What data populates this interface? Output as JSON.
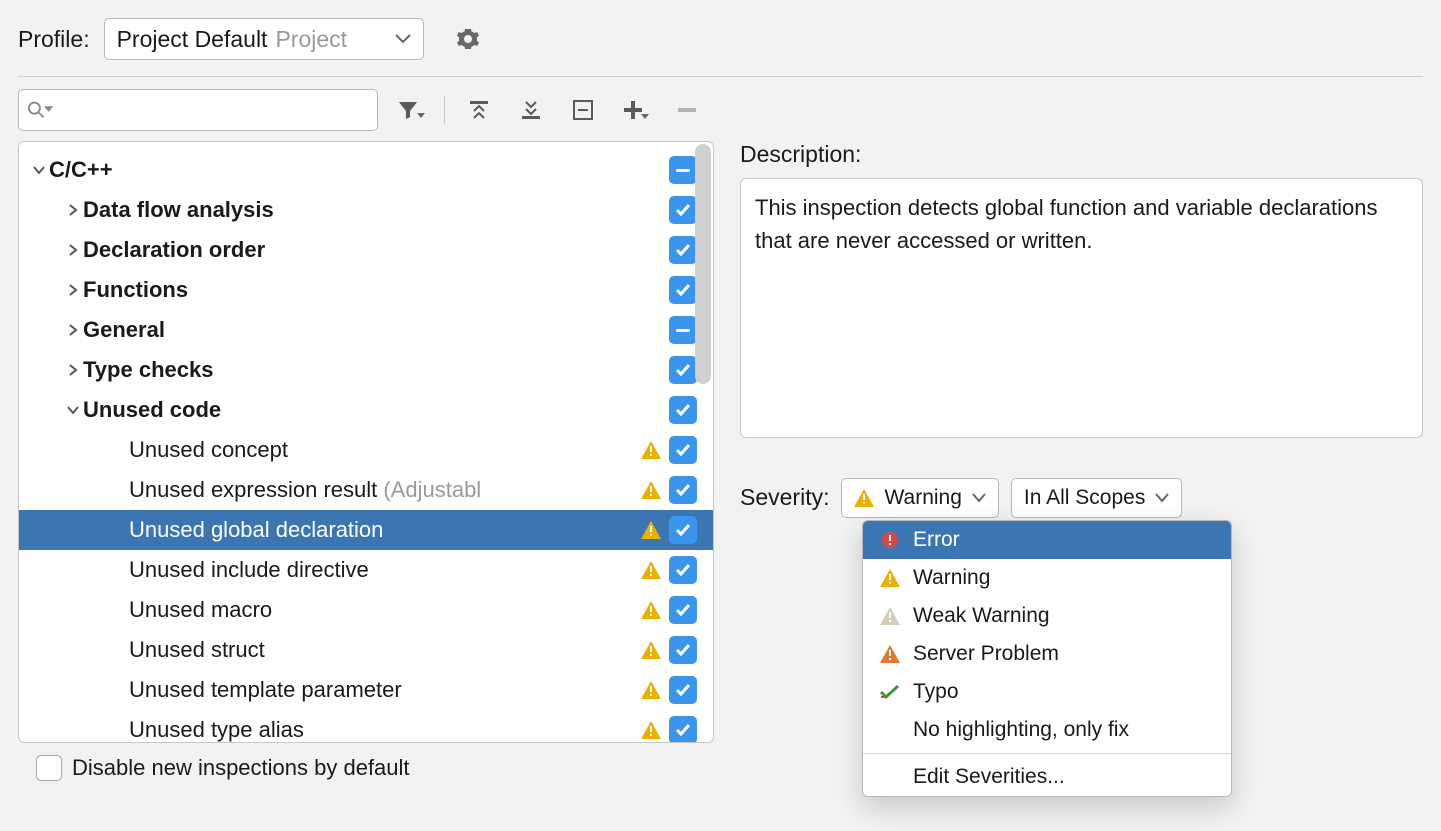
{
  "profile": {
    "label": "Profile:",
    "name": "Project Default",
    "scope": "Project"
  },
  "search": {
    "placeholder": ""
  },
  "tree": {
    "root": "C/C++",
    "groups": [
      {
        "label": "Data flow analysis",
        "bold": true,
        "state": "checked"
      },
      {
        "label": "Declaration order",
        "bold": true,
        "state": "checked"
      },
      {
        "label": "Functions",
        "bold": true,
        "state": "checked"
      },
      {
        "label": "General",
        "bold": true,
        "state": "minus"
      },
      {
        "label": "Type checks",
        "bold": true,
        "state": "checked"
      }
    ],
    "unused_label": "Unused code",
    "unused_items": [
      {
        "label": "Unused concept",
        "warn": true,
        "selected": false
      },
      {
        "label": "Unused expression result ",
        "adj": "(Adjustabl",
        "warn": true,
        "selected": false
      },
      {
        "label": "Unused global declaration",
        "warn": true,
        "selected": true
      },
      {
        "label": "Unused include directive",
        "warn": true,
        "selected": false
      },
      {
        "label": "Unused macro",
        "warn": true,
        "selected": false
      },
      {
        "label": "Unused struct",
        "warn": true,
        "selected": false
      },
      {
        "label": "Unused template parameter",
        "warn": true,
        "selected": false
      },
      {
        "label": "Unused type alias",
        "warn": true,
        "selected": false
      }
    ]
  },
  "disable_label": "Disable new inspections by default",
  "description": {
    "label": "Description:",
    "text": "This inspection detects global function and variable declarations that are never accessed or written."
  },
  "severity": {
    "label": "Severity:",
    "current": "Warning",
    "scope": "In All Scopes",
    "options": [
      {
        "label": "Error",
        "icon": "error",
        "active": true
      },
      {
        "label": "Warning",
        "icon": "warning"
      },
      {
        "label": "Weak Warning",
        "icon": "weak"
      },
      {
        "label": "Server Problem",
        "icon": "server"
      },
      {
        "label": "Typo",
        "icon": "typo"
      },
      {
        "label": "No highlighting, only fix",
        "icon": ""
      }
    ],
    "edit": "Edit Severities..."
  }
}
